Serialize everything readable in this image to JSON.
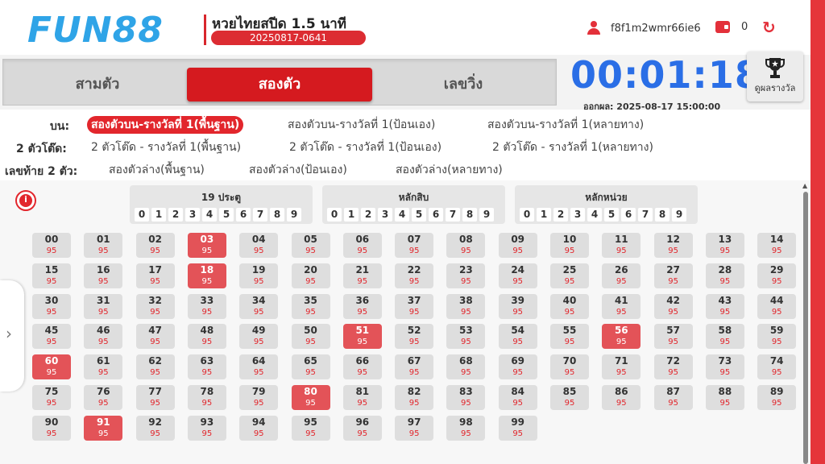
{
  "header": {
    "logo": "FUN88",
    "game_title": "หวยไทยสปีด 1.5 นาที",
    "round_id": "20250817-0641",
    "username": "f8f1m2wmr66ie6",
    "balance": "0"
  },
  "tabs": [
    {
      "label": "สามตัว",
      "active": false
    },
    {
      "label": "สองตัว",
      "active": true
    },
    {
      "label": "เลขวิ่ง",
      "active": false
    }
  ],
  "timer": {
    "countdown": "00:01:18",
    "draw_time": "ออกผล: 2025-08-17 15:00:00"
  },
  "result_button": {
    "label": "ดูผลรางวัล"
  },
  "options": {
    "row1": {
      "label": "บน:",
      "items": [
        "สองตัวบน-รางวัลที่ 1(พื้นฐาน)",
        "สองตัวบน-รางวัลที่ 1(ป้อนเอง)",
        "สองตัวบน-รางวัลที่ 1(หลายทาง)"
      ],
      "active_index": 0
    },
    "row2": {
      "label": "2 ตัวโต๊ด:",
      "items": [
        "2 ตัวโต๊ด - รางวัลที่ 1(พื้นฐาน)",
        "2 ตัวโต๊ด - รางวัลที่ 1(ป้อนเอง)",
        "2 ตัวโต๊ด - รางวัลที่ 1(หลายทาง)"
      ]
    },
    "row3": {
      "label": "เลขท้าย 2 ตัว:",
      "items": [
        "สองตัวล่าง(พื้นฐาน)",
        "สองตัวล่าง(ป้อนเอง)",
        "สองตัวล่าง(หลายทาง)"
      ]
    }
  },
  "info_icon": "i",
  "digit_groups": [
    {
      "title": "19 ประตู",
      "digits": [
        "0",
        "1",
        "2",
        "3",
        "4",
        "5",
        "6",
        "7",
        "8",
        "9"
      ]
    },
    {
      "title": "หลักสิบ",
      "digits": [
        "0",
        "1",
        "2",
        "3",
        "4",
        "5",
        "6",
        "7",
        "8",
        "9"
      ]
    },
    {
      "title": "หลักหน่วย",
      "digits": [
        "0",
        "1",
        "2",
        "3",
        "4",
        "5",
        "6",
        "7",
        "8",
        "9"
      ]
    }
  ],
  "number_grid": {
    "odds": "95",
    "selected": [
      "03",
      "18",
      "51",
      "56",
      "60",
      "80",
      "91"
    ],
    "numbers": [
      "00",
      "01",
      "02",
      "03",
      "04",
      "05",
      "06",
      "07",
      "08",
      "09",
      "10",
      "11",
      "12",
      "13",
      "14",
      "15",
      "16",
      "17",
      "18",
      "19",
      "20",
      "21",
      "22",
      "23",
      "24",
      "25",
      "26",
      "27",
      "28",
      "29",
      "30",
      "31",
      "32",
      "33",
      "34",
      "35",
      "36",
      "37",
      "38",
      "39",
      "40",
      "41",
      "42",
      "43",
      "44",
      "45",
      "46",
      "47",
      "48",
      "49",
      "50",
      "51",
      "52",
      "53",
      "54",
      "55",
      "56",
      "57",
      "58",
      "59",
      "60",
      "61",
      "62",
      "63",
      "64",
      "65",
      "66",
      "67",
      "68",
      "69",
      "70",
      "71",
      "72",
      "73",
      "74",
      "75",
      "76",
      "77",
      "78",
      "79",
      "80",
      "81",
      "82",
      "83",
      "84",
      "85",
      "86",
      "87",
      "88",
      "89",
      "90",
      "91",
      "92",
      "93",
      "94",
      "95",
      "96",
      "97",
      "98",
      "99"
    ]
  },
  "colors": {
    "brand_red": "#e2262c",
    "timer_blue": "#2a6ee6",
    "logo_blue": "#2fa4e7",
    "selected_cell": "#e35358"
  },
  "icons": {
    "user": "user-icon",
    "wallet": "wallet-icon",
    "refresh": "refresh-icon",
    "trophy": "trophy-icon",
    "info": "info-icon",
    "expand": "chevron-right-icon"
  }
}
